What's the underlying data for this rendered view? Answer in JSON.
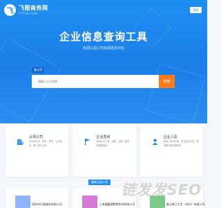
{
  "header": {
    "logo_name": "飞图商务网",
    "logo_domain": "FYT38.COM",
    "login_label": "登录"
  },
  "hero": {
    "title": "企业信息查询工具",
    "subtitle": "免费认领公司获得更多商机",
    "search_tab": "查公司",
    "search_placeholder": "请输入公司名称",
    "search_button": "搜索"
  },
  "cards": [
    {
      "title": "认领公司",
      "desc": "可认领公司，发布、修改、上传信息，推广自己公司",
      "icon": "building-icon",
      "color": "#1f8ef1"
    },
    {
      "title": "企业查询",
      "desc": "查询企业工商、变更、注册、股东、高管等信息",
      "icon": "flag-icon",
      "color": "#1f8ef1"
    },
    {
      "title": "企业入驻",
      "desc": "免费入驻商务网，发布企业信息，提高曝光度获得商机",
      "icon": "user-icon",
      "color": "#1f8ef1"
    }
  ],
  "section": {
    "badge": "最新注册公司"
  },
  "companies": [
    {
      "name": "深圳市乐展服务有限公司",
      "color": "#8fb4ff"
    },
    {
      "name": "上海通鑫通教育科技有限公司",
      "color": "#d67ad8"
    },
    {
      "name": "佛山珠江工艺（苏州）有限公司",
      "color": "#7cc98a"
    }
  ],
  "watermark": "链发发SEO"
}
